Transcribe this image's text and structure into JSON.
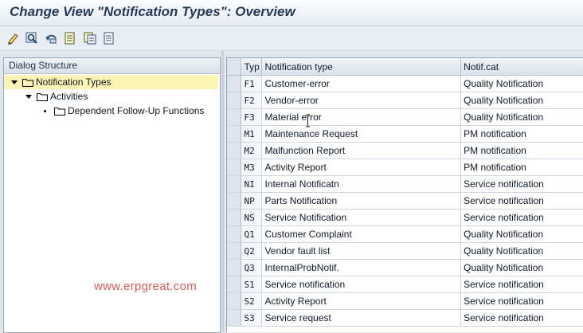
{
  "window": {
    "title": "Change View \"Notification Types\": Overview"
  },
  "toolbar": {
    "icons": [
      "change-display-icon",
      "find-icon",
      "undo-icon",
      "new-entries-icon",
      "copy-as-icon",
      "delete-icon"
    ]
  },
  "dialog_structure": {
    "header": "Dialog Structure",
    "nodes": [
      {
        "label": "Notification Types",
        "level": 0,
        "selected": true
      },
      {
        "label": "Activities",
        "level": 1
      },
      {
        "label": "Dependent Follow-Up Functions",
        "level": 2
      }
    ]
  },
  "table": {
    "columns": [
      "Typ",
      "Notification type",
      "Notif.cat"
    ],
    "rows": [
      {
        "typ": "F1",
        "type": "Customer-error",
        "cat": "Quality Notification"
      },
      {
        "typ": "F2",
        "type": "Vendor-error",
        "cat": "Quality Notification"
      },
      {
        "typ": "F3",
        "type": "Material error",
        "cat": "Quality Notification"
      },
      {
        "typ": "M1",
        "type": "Maintenance Request",
        "cat": "PM notification"
      },
      {
        "typ": "M2",
        "type": "Malfunction Report",
        "cat": "PM notification"
      },
      {
        "typ": "M3",
        "type": "Activity Report",
        "cat": "PM notification"
      },
      {
        "typ": "NI",
        "type": "Internal Notificatn",
        "cat": "Service notification"
      },
      {
        "typ": "NP",
        "type": "Parts Notification",
        "cat": "Service notification"
      },
      {
        "typ": "NS",
        "type": "Service Notification",
        "cat": "Service notification"
      },
      {
        "typ": "Q1",
        "type": "Customer Complaint",
        "cat": "Quality Notification"
      },
      {
        "typ": "Q2",
        "type": "Vendor fault list",
        "cat": "Quality Notification"
      },
      {
        "typ": "Q3",
        "type": "InternalProbNotif.",
        "cat": "Quality Notification"
      },
      {
        "typ": "S1",
        "type": "Service notification",
        "cat": "Service notification"
      },
      {
        "typ": "S2",
        "type": "Activity Report",
        "cat": "Service notification"
      },
      {
        "typ": "S3",
        "type": "Service request",
        "cat": "Service notification"
      }
    ]
  },
  "watermark": "www.erpgreat.com"
}
